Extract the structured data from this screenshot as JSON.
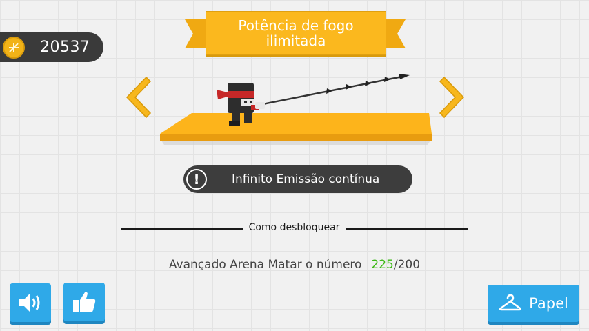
{
  "currency": {
    "coins": "20537",
    "icon": "coin-icon"
  },
  "weapon": {
    "title_line1": "Potência de fogo",
    "title_line2": "ilimitada"
  },
  "ability": {
    "icon": "exclamation-icon",
    "text": "Infinito Emissão contínua"
  },
  "unlock": {
    "heading": "Como desbloquear",
    "requirement": "Avançado Arena Matar o número",
    "current": "225",
    "target": "/200"
  },
  "buttons": {
    "sound_icon": "speaker-icon",
    "like_icon": "thumbs-up-icon",
    "outfit_icon": "hanger-icon",
    "outfit_label": "Papel"
  },
  "colors": {
    "accent_yellow": "#fbb81e",
    "button_blue": "#2fa9e8",
    "progress_green": "#3cb815",
    "dark_pill": "#3a3a3a"
  }
}
